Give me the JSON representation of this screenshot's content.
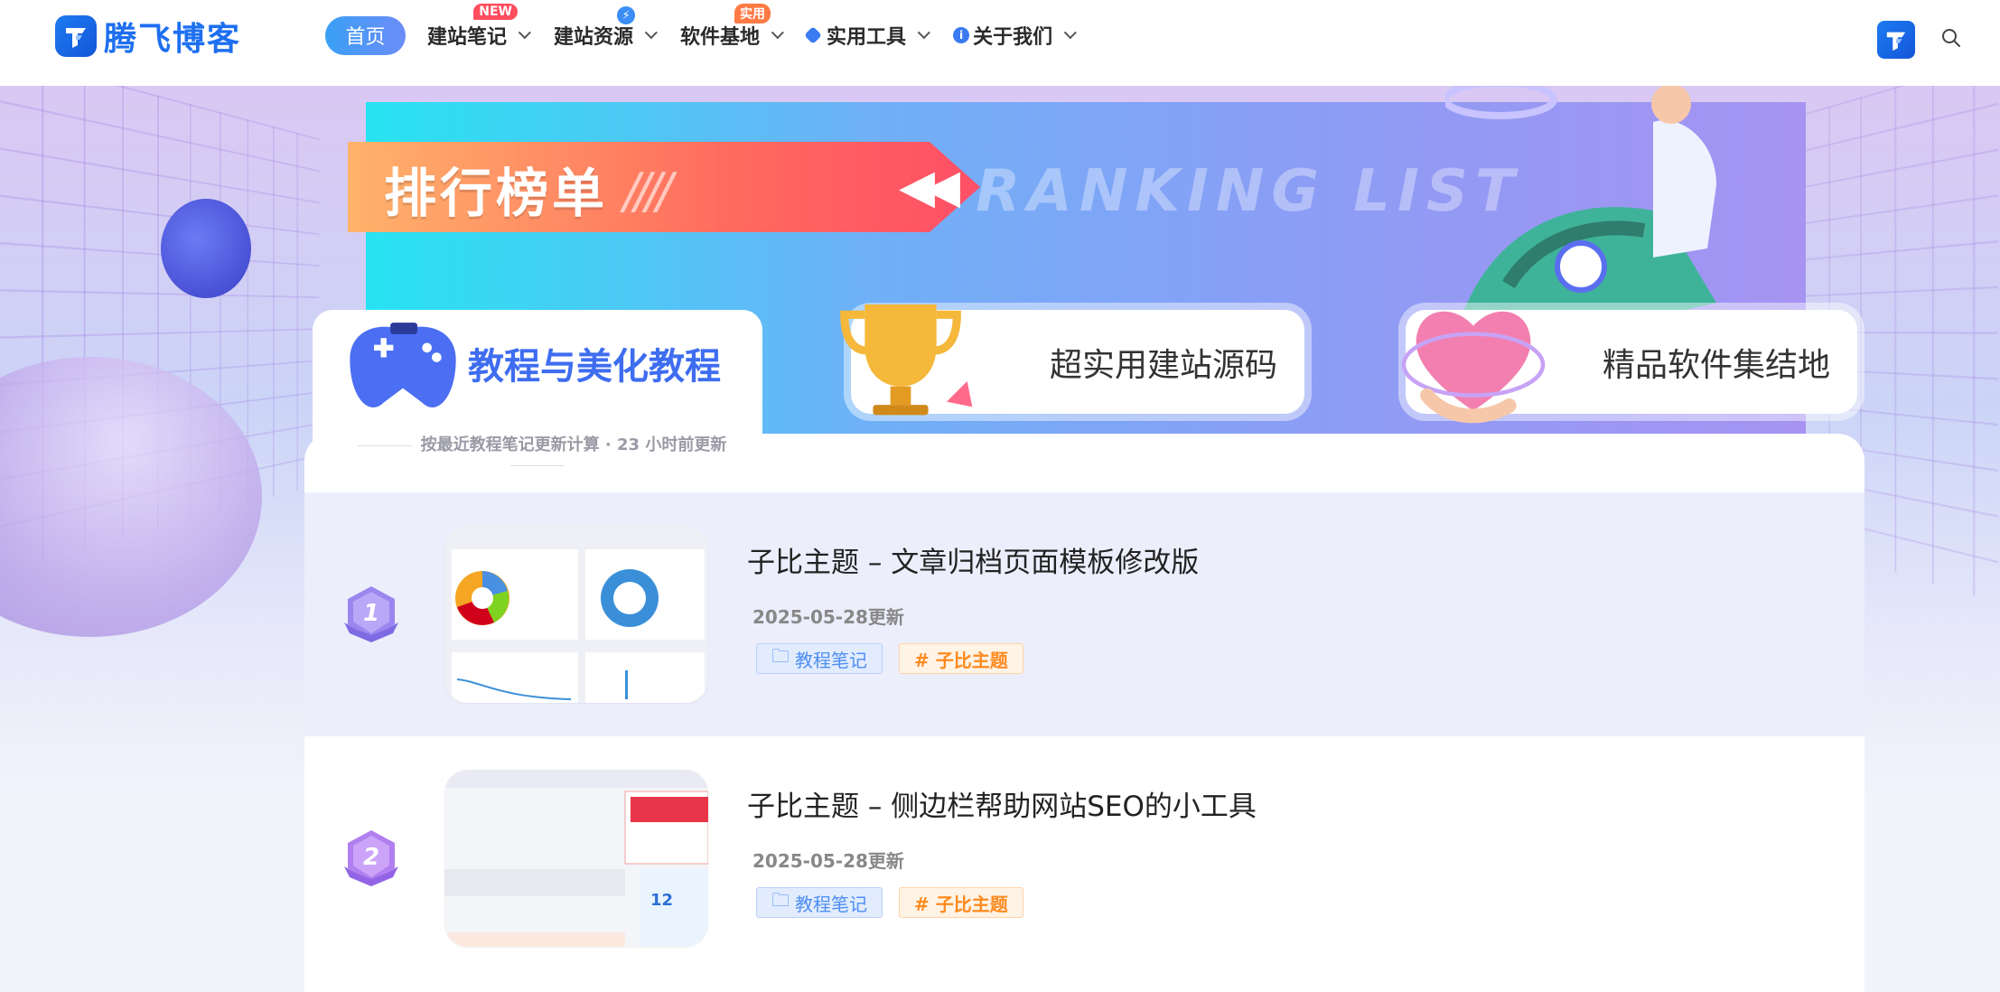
{
  "header": {
    "brand_name": "腾飞博客",
    "nav": {
      "home": "首页",
      "items": [
        {
          "label": "建站笔记",
          "badge": "NEW"
        },
        {
          "label": "建站资源",
          "badge": ""
        },
        {
          "label": "软件基地",
          "badge": "实用"
        },
        {
          "label": "实用工具",
          "badge": ""
        },
        {
          "label": "关于我们",
          "badge": ""
        }
      ]
    }
  },
  "banner": {
    "title": "排行榜单",
    "subtitle_en": "RANKING LIST"
  },
  "categories": [
    {
      "label": "教程与美化教程"
    },
    {
      "label": "超实用建站源码"
    },
    {
      "label": "精品软件集结地"
    }
  ],
  "list": {
    "note": "按最近教程笔记更新计算 · 23 小时前更新",
    "items": [
      {
        "rank": "1",
        "title": "子比主题 – 文章归档页面模板修改版",
        "date": "2025-05-28更新",
        "category": "教程笔记",
        "tag": "# 子比主题"
      },
      {
        "rank": "2",
        "title": "子比主题 – 侧边栏帮助网站SEO的小工具",
        "date": "2025-05-28更新",
        "category": "教程笔记",
        "tag": "# 子比主题"
      }
    ]
  },
  "colors": {
    "brand": "#1e6ff0",
    "accent_badge_new": "#ff4d5e",
    "accent_badge_hot": "#ff7a45",
    "tag_category": "#4d8ef5",
    "tag_topic": "#ff8a1f"
  }
}
